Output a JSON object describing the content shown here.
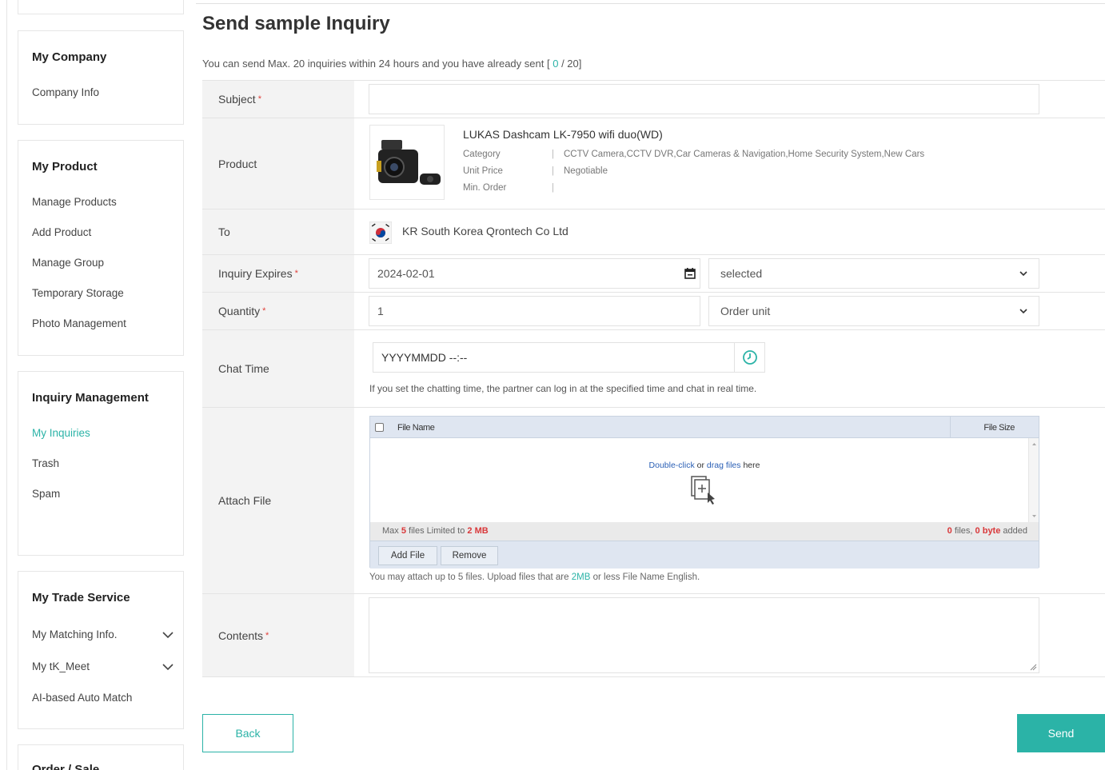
{
  "sidebar": {
    "my_company": {
      "title": "My Company",
      "items": [
        "Company Info"
      ]
    },
    "my_product": {
      "title": "My Product",
      "items": [
        "Manage Products",
        "Add Product",
        "Manage Group",
        "Temporary Storage",
        "Photo Management"
      ]
    },
    "inquiry": {
      "title": "Inquiry Management",
      "items": [
        "My Inquiries",
        "Trash",
        "Spam"
      ],
      "active": "My Inquiries"
    },
    "trade": {
      "title": "My Trade Service",
      "items": [
        "My Matching Info.",
        "My tK_Meet",
        "AI-based Auto Match"
      ]
    },
    "order": {
      "title": "Order / Sale"
    }
  },
  "page": {
    "title": "Send sample Inquiry",
    "limit_prefix": "You can send Max. 20 inquiries within 24 hours and you have already sent [",
    "limit_sent": "0",
    "limit_suffix": "/ 20]"
  },
  "form": {
    "subject": {
      "label": "Subject",
      "value": ""
    },
    "product": {
      "label": "Product",
      "name": "LUKAS Dashcam LK-7950 wifi duo(WD)",
      "category_key": "Category",
      "category_val": "CCTV Camera,CCTV DVR,Car Cameras & Navigation,Home Security System,New Cars",
      "price_key": "Unit Price",
      "price_val": "Negotiable",
      "order_key": "Min. Order",
      "order_val": "",
      "separator": "|"
    },
    "to": {
      "label": "To",
      "value": "KR South Korea Qrontech Co Ltd",
      "flag": "south-korea-flag"
    },
    "expires": {
      "label": "Inquiry Expires",
      "date": "2024-02-01",
      "select": "selected"
    },
    "quantity": {
      "label": "Quantity",
      "value": "1",
      "unit": "Order unit"
    },
    "chat": {
      "label": "Chat Time",
      "placeholder": "YYYYMMDD --:--",
      "note": "If you set the chatting time, the partner can log in at the specified time and chat in real time."
    },
    "attach": {
      "label": "Attach File",
      "col_name": "File Name",
      "col_size": "File Size",
      "drop_dbl": "Double-click",
      "drop_or": "or",
      "drop_drag": "drag files",
      "drop_here": "here",
      "max_prefix": "Max",
      "max_files": "5",
      "max_mid": "files Limited to",
      "max_size": "2 MB",
      "count_files": "0",
      "count_files_word": "files,",
      "count_bytes": "0 byte",
      "count_added": "added",
      "add_btn": "Add File",
      "remove_btn": "Remove",
      "note_prefix": "You may attach up to 5 files. Upload files that are",
      "note_size": "2MB",
      "note_suffix": "or less File Name English."
    },
    "contents": {
      "label": "Contents",
      "value": ""
    },
    "required_mark": "*"
  },
  "buttons": {
    "back": "Back",
    "send": "Send"
  },
  "colors": {
    "accent": "#2bb3a7",
    "required": "#e0403a"
  }
}
